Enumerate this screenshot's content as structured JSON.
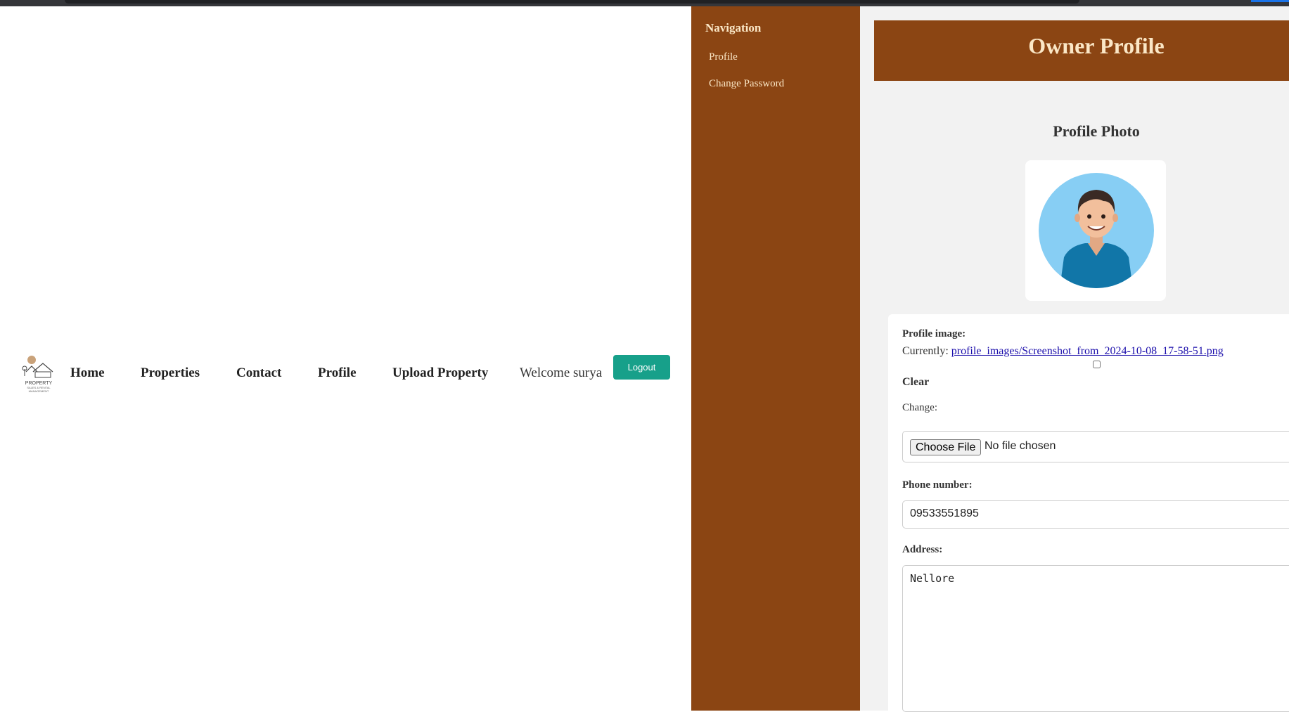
{
  "header": {
    "logo_text": "PROPERTY SALES & RENTAL MANAGEMENT",
    "nav": [
      "Home",
      "Properties",
      "Contact",
      "Profile",
      "Upload Property"
    ],
    "welcome": "Welcome surya",
    "logout_label": "Logout"
  },
  "sidebar": {
    "title": "Navigation",
    "items": [
      "Profile",
      "Change Password"
    ]
  },
  "main": {
    "banner_title": "Owner Profile",
    "photo_heading": "Profile Photo"
  },
  "form": {
    "profile_image_label": "Profile image:",
    "currently_label": "Currently:",
    "current_file": "profile_images/Screenshot_from_2024-10-08_17-58-51.png",
    "clear_label": "Clear",
    "change_label": "Change:",
    "choose_file_label": "Choose File",
    "no_file_text": "No file chosen",
    "phone_label": "Phone number:",
    "phone_value": "09533551895",
    "address_label": "Address:",
    "address_value": "Nellore"
  },
  "colors": {
    "brown": "#8b4513",
    "cream": "#fbe7c6",
    "logout_green": "#17a08a",
    "avatar_blue": "#87cef4"
  }
}
